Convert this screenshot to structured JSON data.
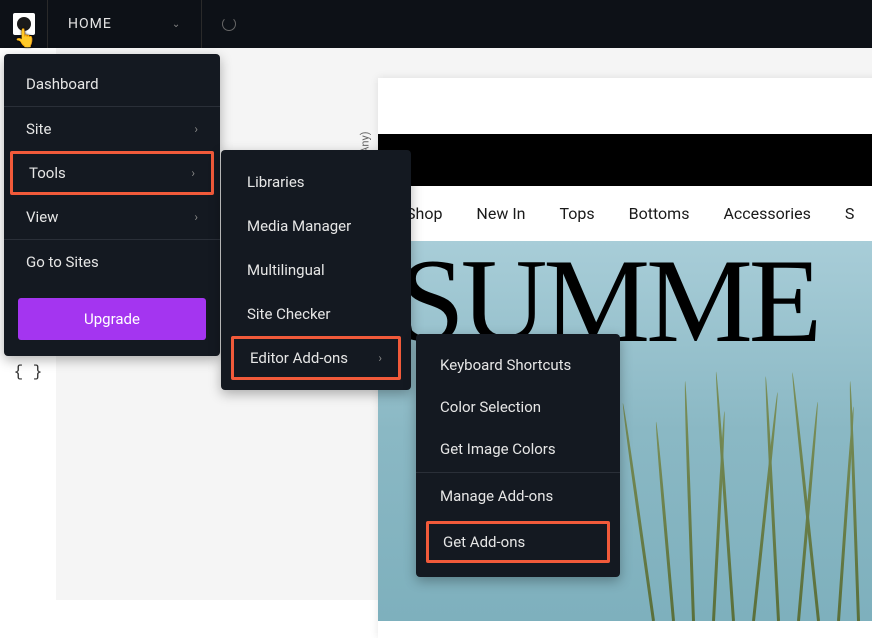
{
  "topbar": {
    "home_label": "HOME"
  },
  "sidebar": {
    "icons": [
      "grid-icon",
      "braces-icon"
    ]
  },
  "menu1": {
    "dashboard": "Dashboard",
    "site": "Site",
    "tools": "Tools",
    "view": "View",
    "go_to_sites": "Go to Sites",
    "upgrade": "Upgrade"
  },
  "menu2": {
    "libraries": "Libraries",
    "media_manager": "Media Manager",
    "multilingual": "Multilingual",
    "site_checker": "Site Checker",
    "editor_addons": "Editor Add-ons"
  },
  "menu3": {
    "keyboard_shortcuts": "Keyboard Shortcuts",
    "color_selection": "Color Selection",
    "get_image_colors": "Get Image Colors",
    "manage_addons": "Manage Add-ons",
    "get_addons": "Get Add-ons"
  },
  "canvas": {
    "label_any": "(Any)",
    "nav": [
      "Shop",
      "New In",
      "Tops",
      "Bottoms",
      "Accessories",
      "S"
    ],
    "hero_title": "SUMME"
  }
}
